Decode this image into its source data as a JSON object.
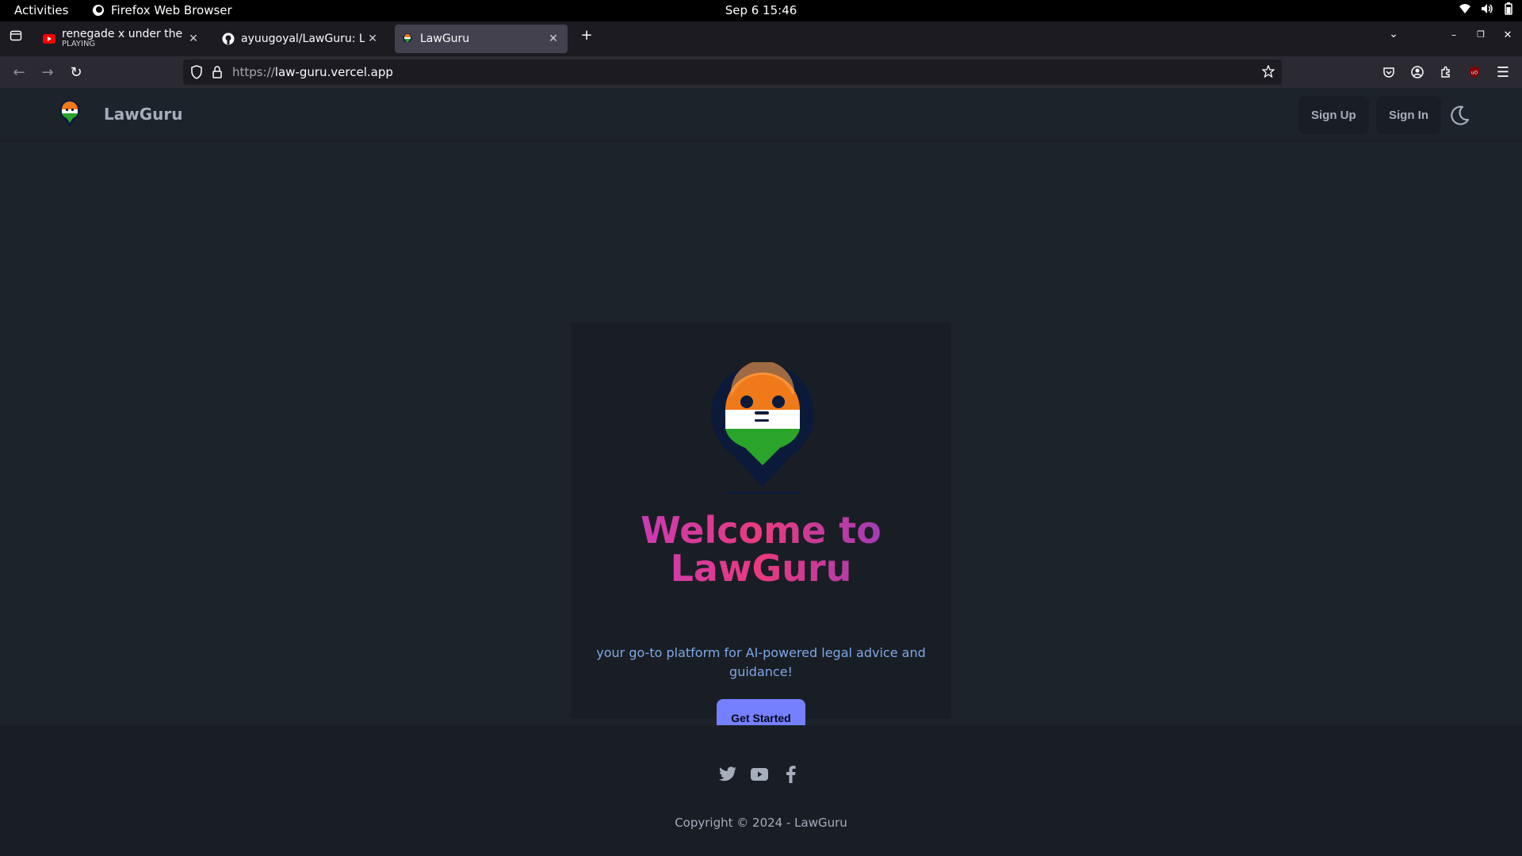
{
  "system": {
    "activities": "Activities",
    "app_name": "Firefox Web Browser",
    "clock": "Sep 6  15:46"
  },
  "browser": {
    "tabs": [
      {
        "title": "renegade x under the influence",
        "subtitle": "PLAYING",
        "favicon": "youtube-icon"
      },
      {
        "title": "ayuugoyal/LawGuru: LawGuru",
        "favicon": "github-icon"
      },
      {
        "title": "LawGuru",
        "favicon": "lawguru-favicon",
        "active": true
      }
    ],
    "url_scheme": "https://",
    "url_host": "law-guru.vercel.app"
  },
  "site": {
    "brand": "LawGuru",
    "nav": {
      "sign_up": "Sign Up",
      "sign_in": "Sign In"
    },
    "hero": {
      "title_line1": "Welcome to",
      "title_line2": "LawGuru",
      "tagline": "your go-to platform for AI-powered legal advice and guidance!",
      "cta": "Get Started"
    },
    "footer": {
      "social": [
        "twitter-icon",
        "youtube-icon",
        "facebook-icon"
      ],
      "copyright": "Copyright © 2024 - LawGuru"
    }
  },
  "colors": {
    "background": "#1d232a",
    "card": "#191e24",
    "primary": "#7480ff",
    "tagline": "#7fa7e8"
  }
}
